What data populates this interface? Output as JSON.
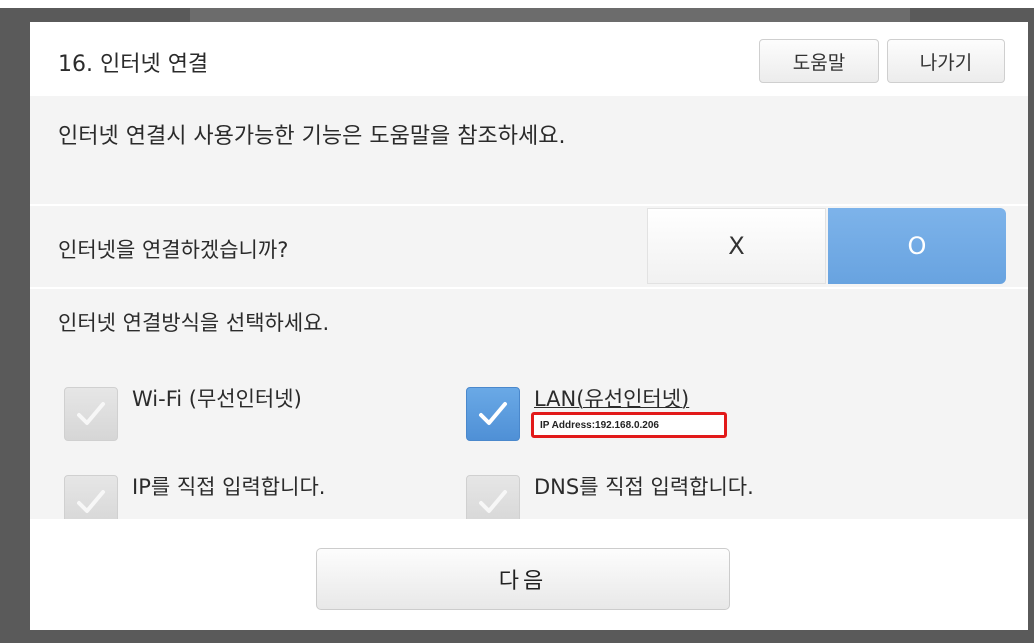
{
  "dialog": {
    "title": "16. 인터넷 연결",
    "help_label": "도움말",
    "exit_label": "나가기"
  },
  "notice": "인터넷 연결시 사용가능한 기능은 도움말을 참조하세요.",
  "connect": {
    "question": "인터넷을 연결하겠습니까?",
    "option_no": "X",
    "option_yes": "O",
    "selected": "O"
  },
  "method": {
    "title": "인터넷 연결방식을 선택하세요.",
    "options": [
      {
        "label": "Wi-Fi (무선인터넷)",
        "checked": false
      },
      {
        "label": "LAN(유선인터넷)",
        "checked": true,
        "detail": "IP Address:192.168.0.206"
      },
      {
        "label": "IP를 직접 입력합니다.",
        "checked": false
      },
      {
        "label": "DNS를 직접 입력합니다.",
        "checked": false
      }
    ]
  },
  "footer": {
    "next_label": "다음"
  },
  "colors": {
    "accent": "#6aa9e6",
    "highlight_border": "#e21a1a",
    "backdrop": "#5a5a5a"
  },
  "icons": {
    "checkbox_mark": "check-icon"
  }
}
